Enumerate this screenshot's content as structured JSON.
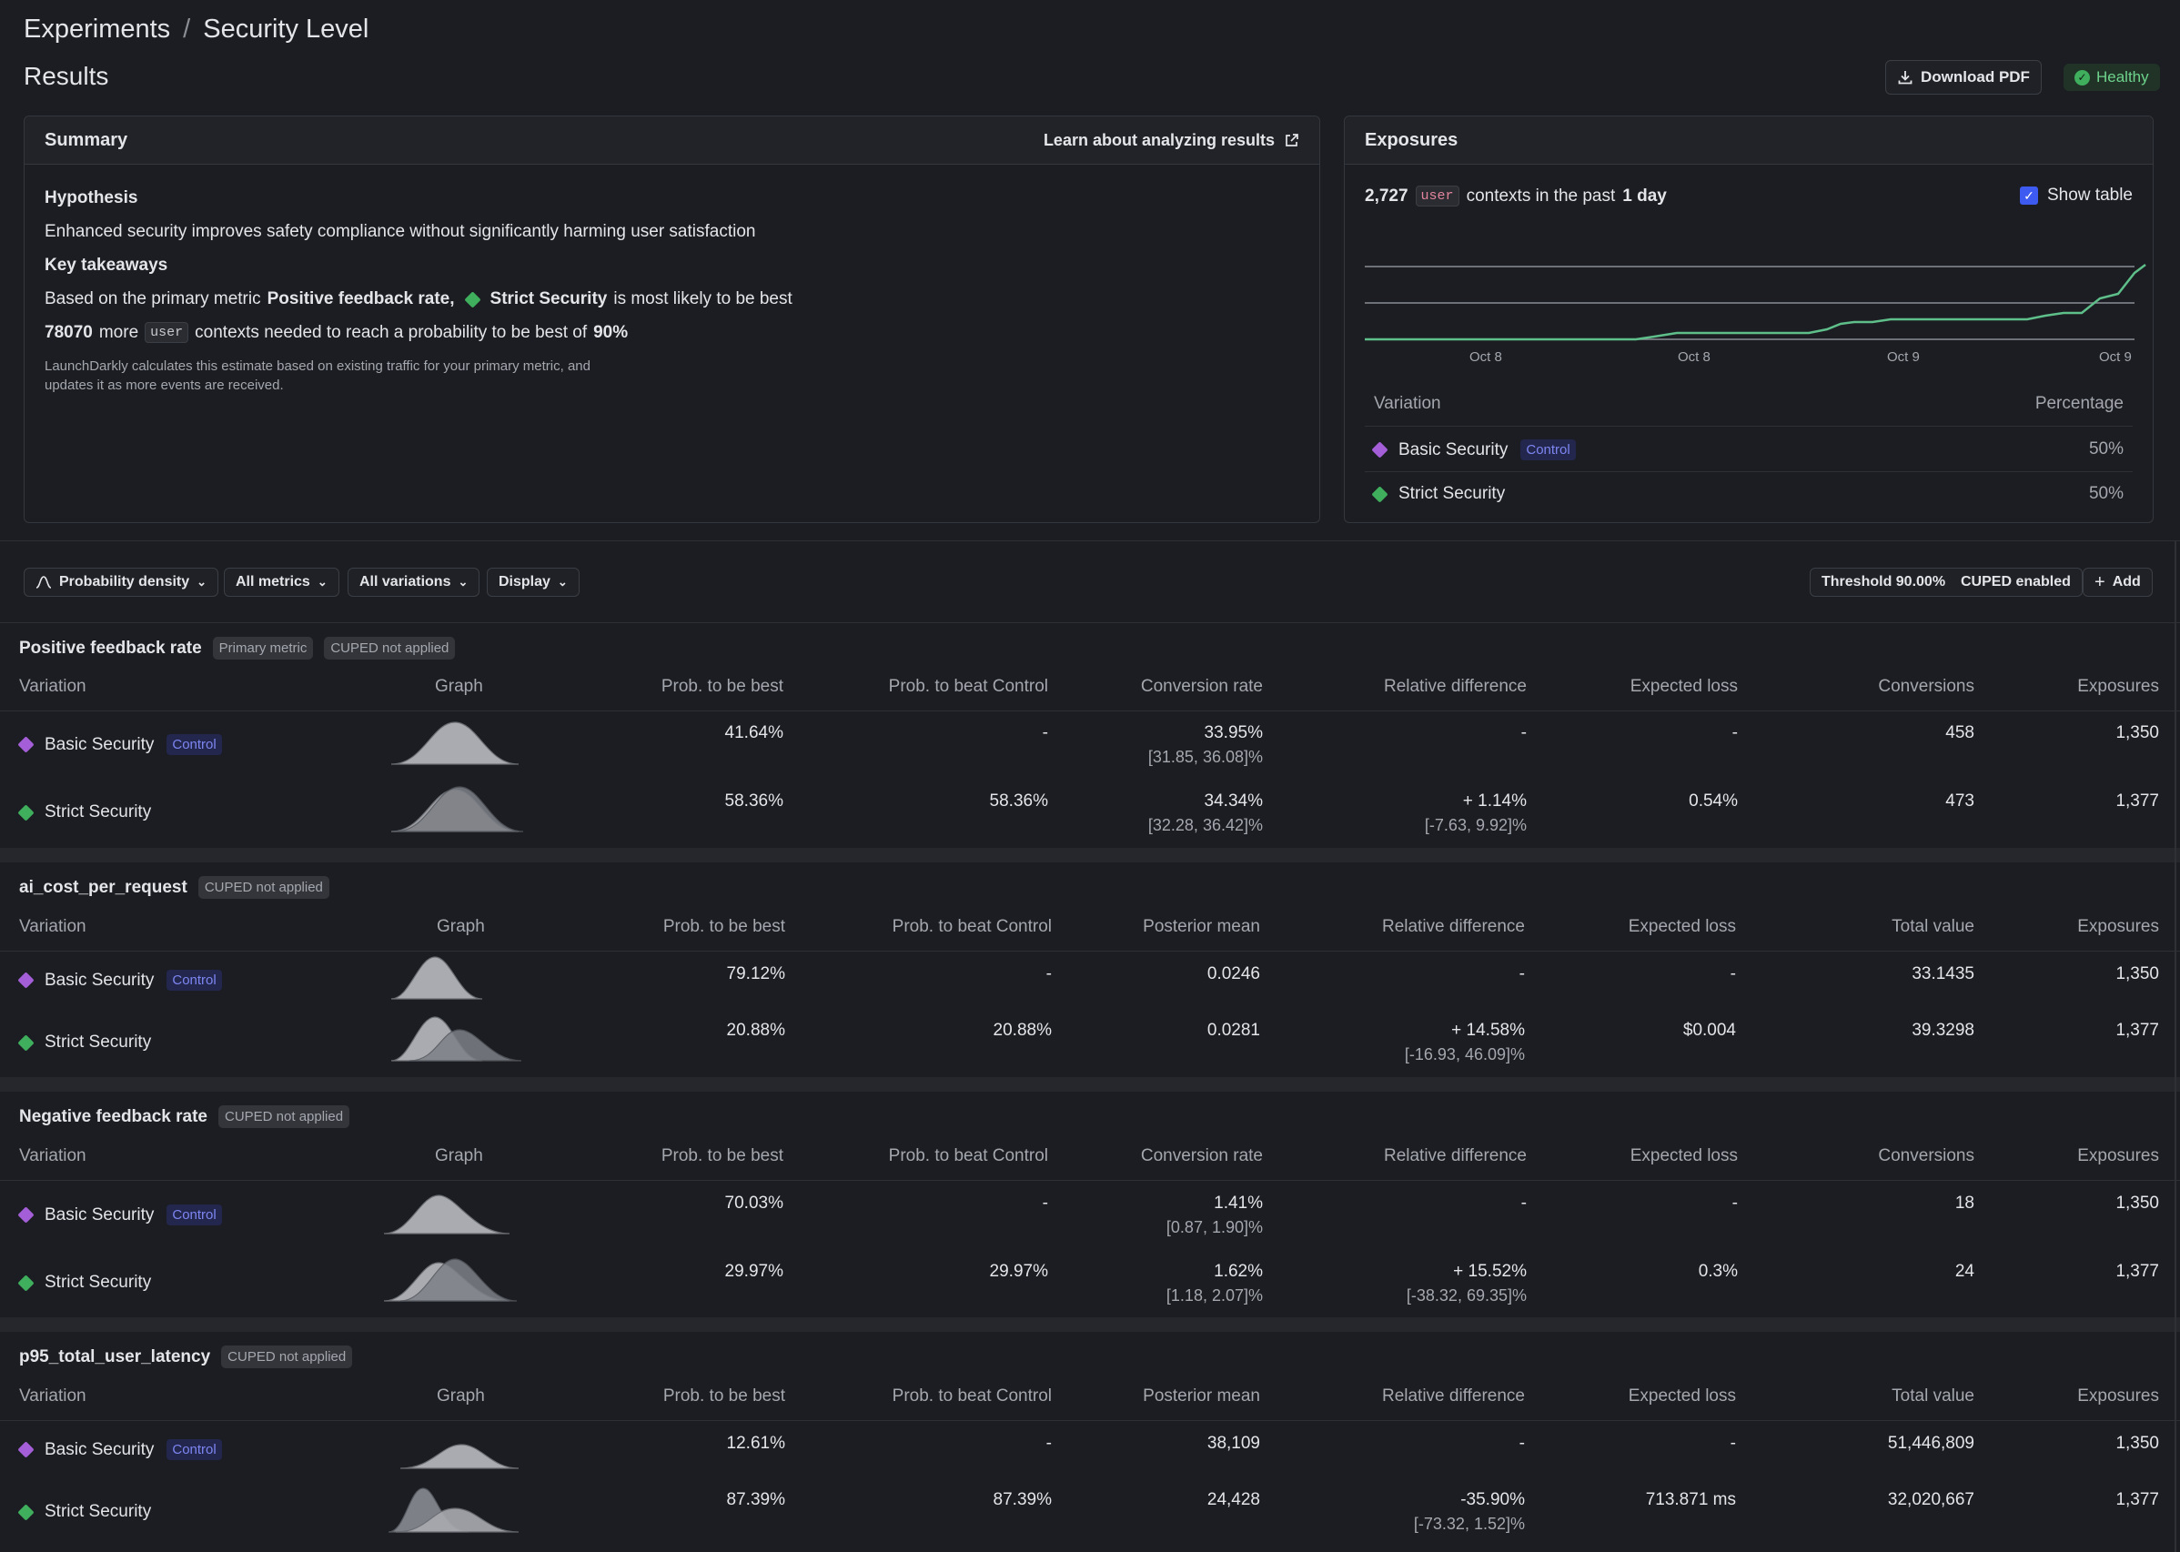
{
  "breadcrumb": {
    "root": "Experiments",
    "separator": "/",
    "current": "Security Level"
  },
  "page_title": "Results",
  "actions": {
    "download_pdf": "Download PDF",
    "health": "Healthy"
  },
  "summary": {
    "title": "Summary",
    "learn_link": "Learn about analyzing results",
    "hypothesis_heading": "Hypothesis",
    "hypothesis_text": "Enhanced security improves safety compliance without significantly harming user satisfaction",
    "takeaways_heading": "Key takeaways",
    "line1_prefix": "Based on the primary metric",
    "line1_metric": "Positive feedback rate,",
    "line1_variation": "Strict Security",
    "line1_suffix": "is most likely to be best",
    "line2_count": "78070",
    "line2_more": "more",
    "line2_code": "user",
    "line2_mid": "contexts needed to reach a probability to be best of",
    "line2_pct": "90%",
    "note_line1": "LaunchDarkly calculates this estimate based on existing traffic for your primary metric, and",
    "note_line2": "updates it as more events are received."
  },
  "exposures": {
    "title": "Exposures",
    "count": "2,727",
    "code": "user",
    "mid": "contexts in the past",
    "period": "1 day",
    "show_table": "Show table",
    "x_ticks": [
      "Oct 8",
      "Oct 8",
      "Oct 9",
      "Oct 9"
    ],
    "table_headers": {
      "variation": "Variation",
      "percentage": "Percentage"
    },
    "rows": [
      {
        "name": "Basic Security",
        "control": "Control",
        "pct": "50%"
      },
      {
        "name": "Strict Security",
        "control": "",
        "pct": "50%"
      }
    ]
  },
  "toolbar": {
    "density": "Probability density",
    "metrics": "All metrics",
    "variations": "All variations",
    "display": "Display",
    "threshold": "Threshold 90.00%",
    "cuped": "CUPED enabled",
    "add": "Add"
  },
  "metrics": [
    {
      "name": "Positive feedback rate",
      "badges": [
        "Primary metric",
        "CUPED not applied"
      ],
      "headers": [
        "Variation",
        "Graph",
        "Prob. to be best",
        "Prob. to beat Control",
        "Conversion rate",
        "Relative difference",
        "Expected loss",
        "Conversions",
        "Exposures"
      ],
      "rows": [
        {
          "variation": "Basic Security",
          "control": "Control",
          "best": "41.64%",
          "beat": "-",
          "rate": "33.95%",
          "rate_ci": "[31.85, 36.08]%",
          "rel": "-",
          "rel_ci": "",
          "loss": "-",
          "total": "458",
          "exposures": "1,350"
        },
        {
          "variation": "Strict Security",
          "control": "",
          "best": "58.36%",
          "beat": "58.36%",
          "rate": "34.34%",
          "rate_ci": "[32.28, 36.42]%",
          "rel": "+ 1.14%",
          "rel_ci": "[-7.63, 9.92]%",
          "loss": "0.54%",
          "total": "473",
          "exposures": "1,377"
        }
      ]
    },
    {
      "name": "ai_cost_per_request",
      "badges": [
        "CUPED not applied"
      ],
      "headers": [
        "Variation",
        "Graph",
        "Prob. to be best",
        "Prob. to beat Control",
        "Posterior mean",
        "Relative difference",
        "Expected loss",
        "Total value",
        "Exposures"
      ],
      "rows": [
        {
          "variation": "Basic Security",
          "control": "Control",
          "best": "79.12%",
          "beat": "-",
          "rate": "0.0246",
          "rate_ci": "",
          "rel": "-",
          "rel_ci": "",
          "loss": "-",
          "total": "33.1435",
          "exposures": "1,350"
        },
        {
          "variation": "Strict Security",
          "control": "",
          "best": "20.88%",
          "beat": "20.88%",
          "rate": "0.0281",
          "rate_ci": "",
          "rel": "+ 14.58%",
          "rel_ci": "[-16.93, 46.09]%",
          "loss": "$0.004",
          "total": "39.3298",
          "exposures": "1,377"
        }
      ]
    },
    {
      "name": "Negative feedback rate",
      "badges": [
        "CUPED not applied"
      ],
      "headers": [
        "Variation",
        "Graph",
        "Prob. to be best",
        "Prob. to beat Control",
        "Conversion rate",
        "Relative difference",
        "Expected loss",
        "Conversions",
        "Exposures"
      ],
      "rows": [
        {
          "variation": "Basic Security",
          "control": "Control",
          "best": "70.03%",
          "beat": "-",
          "rate": "1.41%",
          "rate_ci": "[0.87, 1.90]%",
          "rel": "-",
          "rel_ci": "",
          "loss": "-",
          "total": "18",
          "exposures": "1,350"
        },
        {
          "variation": "Strict Security",
          "control": "",
          "best": "29.97%",
          "beat": "29.97%",
          "rate": "1.62%",
          "rate_ci": "[1.18, 2.07]%",
          "rel": "+ 15.52%",
          "rel_ci": "[-38.32, 69.35]%",
          "loss": "0.3%",
          "total": "24",
          "exposures": "1,377"
        }
      ]
    },
    {
      "name": "p95_total_user_latency",
      "badges": [
        "CUPED not applied"
      ],
      "headers": [
        "Variation",
        "Graph",
        "Prob. to be best",
        "Prob. to beat Control",
        "Posterior mean",
        "Relative difference",
        "Expected loss",
        "Total value",
        "Exposures"
      ],
      "rows": [
        {
          "variation": "Basic Security",
          "control": "Control",
          "best": "12.61%",
          "beat": "-",
          "rate": "38,109",
          "rate_ci": "",
          "rel": "-",
          "rel_ci": "",
          "loss": "-",
          "total": "51,446,809",
          "exposures": "1,350"
        },
        {
          "variation": "Strict Security",
          "control": "",
          "best": "87.39%",
          "beat": "87.39%",
          "rate": "24,428",
          "rate_ci": "",
          "rel": "-35.90%",
          "rel_ci": "[-73.32, 1.52]%",
          "loss": "713.871 ms",
          "total": "32,020,667",
          "exposures": "1,377"
        }
      ]
    }
  ]
}
